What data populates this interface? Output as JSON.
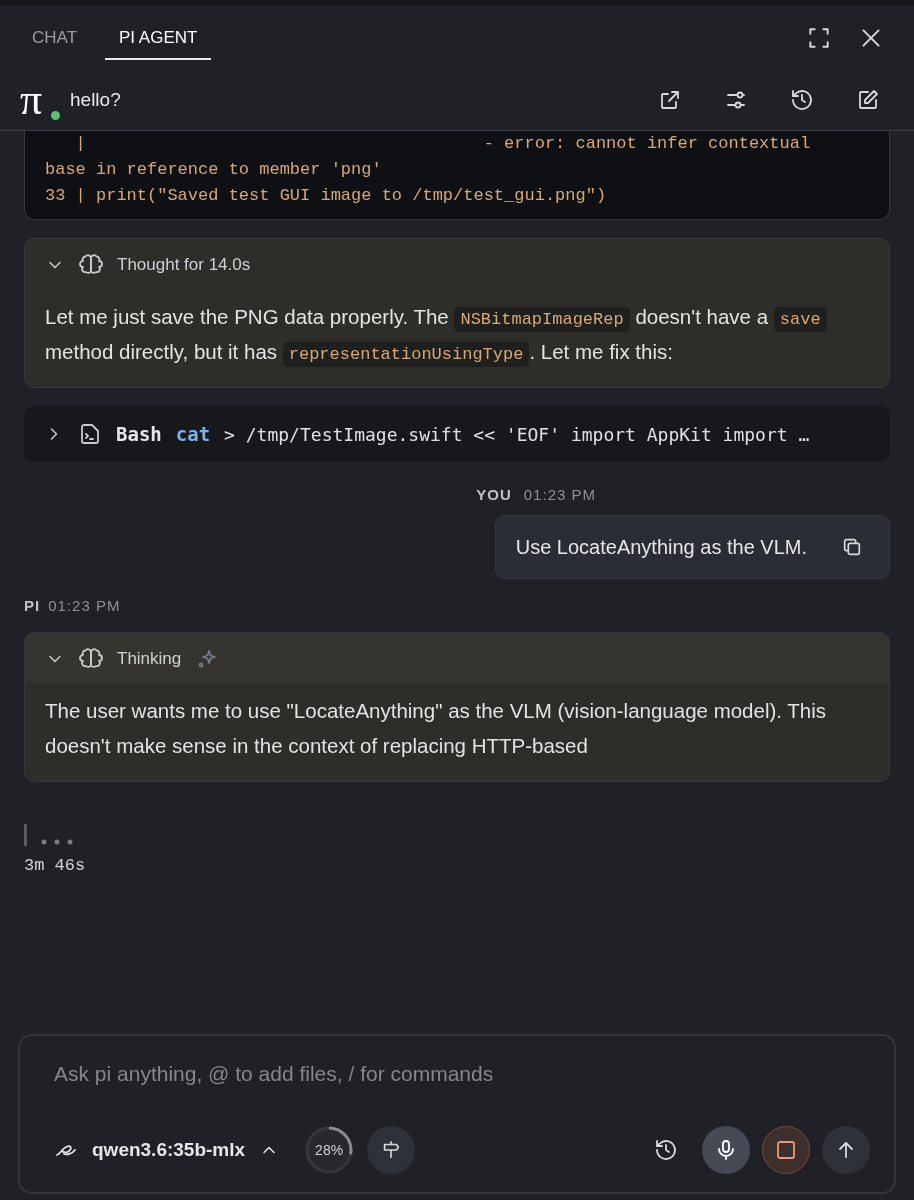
{
  "tabs": [
    {
      "label": "CHAT",
      "selected": false
    },
    {
      "label": "PI AGENT",
      "selected": true
    }
  ],
  "header": {
    "logo": "π",
    "title": "hello?",
    "online": true
  },
  "messages": [
    {
      "kind": "code",
      "lines": [
        "   |                                       - error: cannot infer contextual",
        "base in reference to member 'png'",
        "33 | print(\"Saved test GUI image to /tmp/test_gui.png\")"
      ]
    },
    {
      "kind": "thought",
      "expanded": true,
      "streaming": false,
      "title": "Thought for 14.0s",
      "parts": [
        {
          "text": "Let me just save the PNG data properly. The ",
          "kind": "text"
        },
        {
          "text": "NSBitmapImageRep",
          "kind": "code"
        },
        {
          "text": " doesn't have a ",
          "kind": "text"
        },
        {
          "text": "save",
          "kind": "code"
        },
        {
          "text": " method directly, but it has ",
          "kind": "text"
        },
        {
          "text": "representationUsingType",
          "kind": "code"
        },
        {
          "text": ". Let me fix this:",
          "kind": "text"
        }
      ]
    },
    {
      "kind": "tool",
      "expanded": false,
      "name": "Bash",
      "command": "cat",
      "args": "> /tmp/TestImage.swift << 'EOF' import AppKit import …"
    },
    {
      "kind": "user",
      "author": "YOU",
      "time": "01:23 PM",
      "text": "Use LocateAnything as the VLM."
    },
    {
      "kind": "author",
      "author": "PI",
      "time": "01:23 PM"
    },
    {
      "kind": "thought",
      "expanded": true,
      "streaming": true,
      "title": "Thinking",
      "parts": [
        {
          "text": "The user wants me to use \"LocateAnything\" as the VLM (vision-language model). This doesn't make sense in the context of replacing HTTP-based",
          "kind": "text"
        }
      ]
    },
    {
      "kind": "typing",
      "elapsed": "3m 46s"
    }
  ],
  "composer": {
    "placeholder": "Ask pi anything, @ to add files, / for commands",
    "model": "qwen3.6:35b-mlx",
    "context": {
      "reading": "28%",
      "level": 0.28
    },
    "recording": true
  }
}
